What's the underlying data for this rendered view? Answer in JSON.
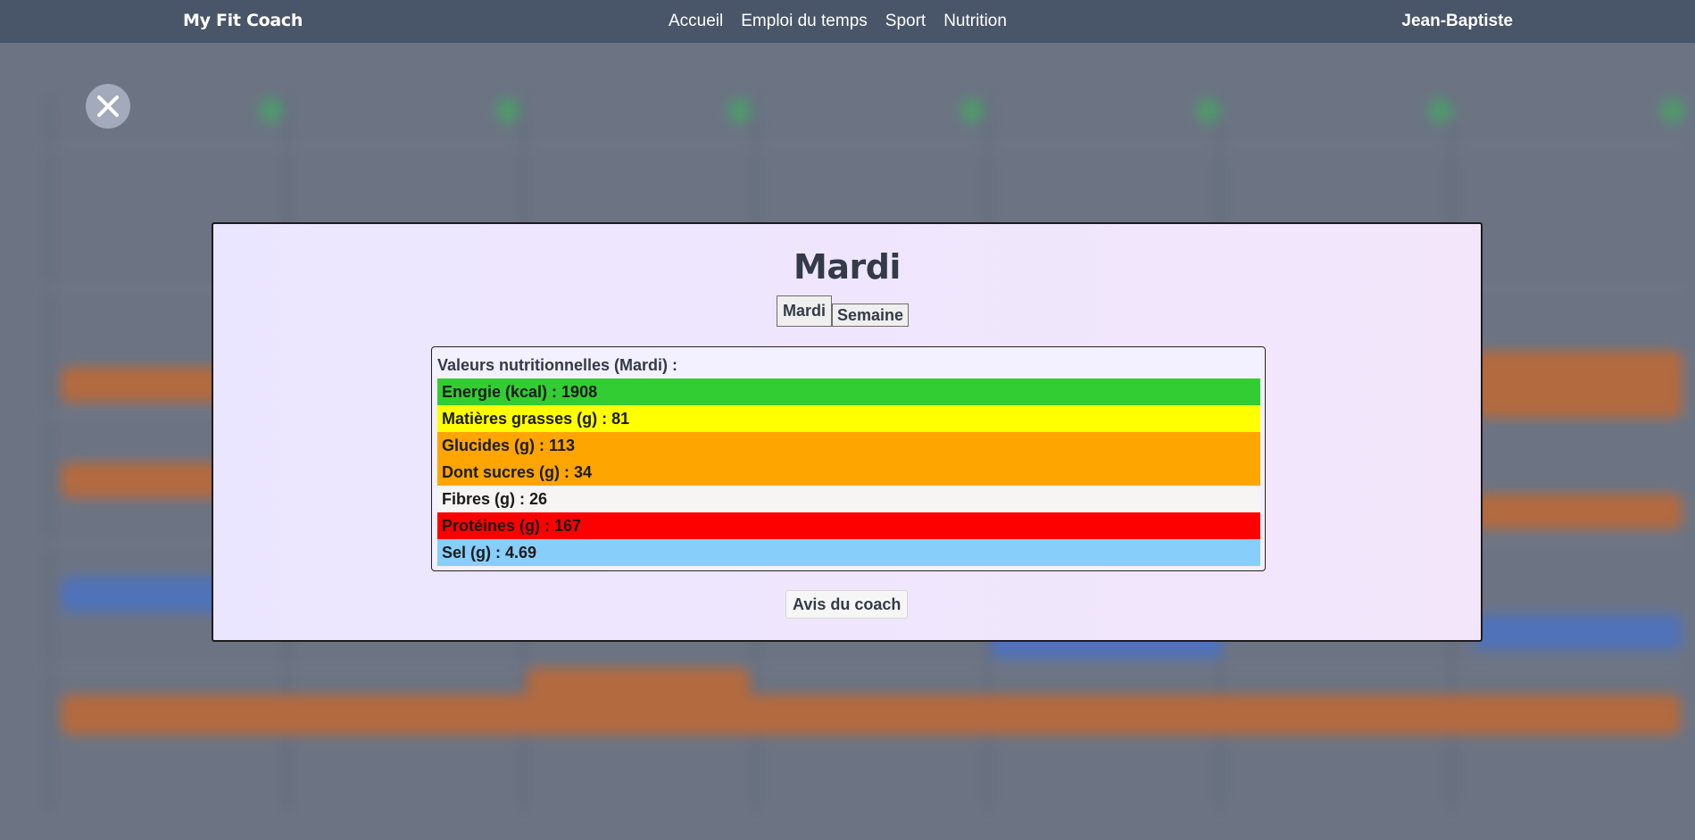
{
  "navbar": {
    "brand": "My Fit Coach",
    "links": [
      {
        "label": "Accueil"
      },
      {
        "label": "Emploi du temps"
      },
      {
        "label": "Sport"
      },
      {
        "label": "Nutrition"
      }
    ],
    "user": "Jean-Baptiste"
  },
  "close_icon": "close-x-icon",
  "modal": {
    "title": "Mardi",
    "tabs": [
      {
        "label": "Mardi",
        "active": true
      },
      {
        "label": "Semaine",
        "active": false
      }
    ],
    "nutrition": {
      "heading": "Valeurs nutritionnelles (Mardi) :",
      "rows": [
        {
          "text": "Energie (kcal) : 1908",
          "color": "#32cd32"
        },
        {
          "text": "Matières grasses (g) : 81",
          "color": "#ffff00"
        },
        {
          "text": "Glucides (g) : 113",
          "color": "#ffa500"
        },
        {
          "text": "Dont sucres (g) : 34",
          "color": "#ffa500"
        },
        {
          "text": "Fibres (g) : 26",
          "color": "#f7f5f3"
        },
        {
          "text": "Protéines (g) : 167",
          "color": "#ff0000"
        },
        {
          "text": "Sel (g) : 4.69",
          "color": "#87cefa"
        }
      ]
    },
    "coach_button": "Avis du coach"
  },
  "colors": {
    "navbar": "#495568",
    "overlay": "#6c7484",
    "modal_bg": "#ede6fd",
    "text_dark": "#333a48"
  }
}
